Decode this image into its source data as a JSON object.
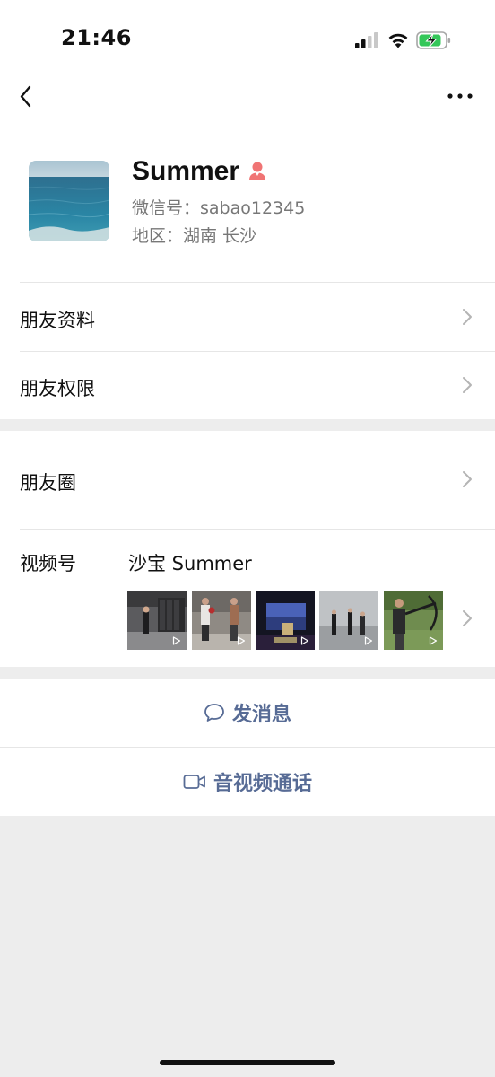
{
  "status_bar": {
    "time": "21:46",
    "icons": [
      "signal-icon",
      "wifi-icon",
      "battery-charging-icon"
    ],
    "battery_color": "#34c759"
  },
  "nav": {
    "back_icon": "back-icon",
    "more_icon": "more-icon"
  },
  "profile": {
    "name": "Summer",
    "wechat_id": "微信号：sabao12345",
    "region": "地区：湖南 长沙",
    "gender_icon_color": "#f07474"
  },
  "menu": {
    "friend_info": "朋友资料",
    "friend_permissions": "朋友权限",
    "moments": "朋友圈",
    "channels_label": "视频号",
    "channels_name": "沙宝 Summer",
    "channels_thumbnail_count": 5
  },
  "actions": {
    "send_message": "发消息",
    "av_call": "音视频通话",
    "link_color": "#576b95"
  }
}
